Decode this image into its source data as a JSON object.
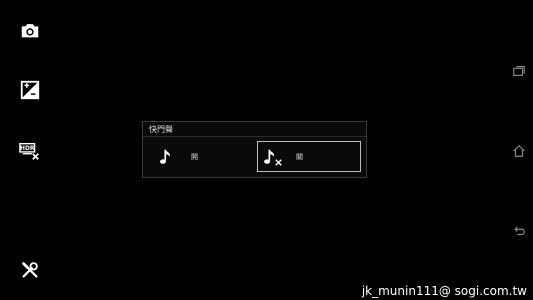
{
  "left_bar": {
    "items": [
      {
        "icon": "camera-icon"
      },
      {
        "icon": "exposure-icon"
      },
      {
        "icon": "hdr-off-icon"
      },
      {
        "icon": "settings-tools-icon"
      }
    ]
  },
  "right_bar": {
    "items": [
      {
        "icon": "recent-apps-icon"
      },
      {
        "icon": "home-icon"
      },
      {
        "icon": "back-icon"
      }
    ]
  },
  "shutter_sound_dialog": {
    "title": "快門聲",
    "options": [
      {
        "label": "開",
        "icon": "music-note-icon",
        "selected": false
      },
      {
        "label": "關",
        "icon": "music-note-off-icon",
        "selected": true
      }
    ]
  },
  "watermark": "jk_munin111@ sogi.com.tw"
}
